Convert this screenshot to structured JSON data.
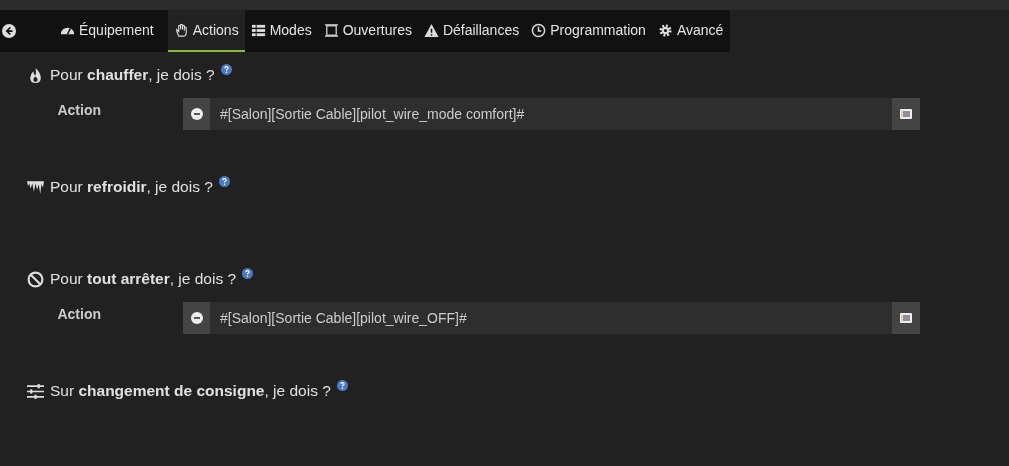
{
  "tabs": [
    {
      "label": "Équipement",
      "selected": false
    },
    {
      "label": "Actions",
      "selected": true
    },
    {
      "label": "Modes",
      "selected": false
    },
    {
      "label": "Ouvertures",
      "selected": false
    },
    {
      "label": "Défaillances",
      "selected": false
    },
    {
      "label": "Programmation",
      "selected": false
    },
    {
      "label": "Avancé",
      "selected": false
    }
  ],
  "sections": [
    {
      "title": "Pour **chauffer**, je dois ?",
      "actions": [
        {
          "label": "Action",
          "value": "#[Salon][Sortie Cable][pilot_wire_mode comfort]#"
        }
      ]
    },
    {
      "title": "Pour **refroidir**, je dois ?"
    },
    {
      "title": "Pour **tout arrêter**, je dois ?",
      "actions": [
        {
          "label": "Action",
          "value": "#[Salon][Sortie Cable][pilot_wire_OFF]#"
        }
      ]
    },
    {
      "title": "Sur **changement de consigne**, je dois ?"
    }
  ]
}
